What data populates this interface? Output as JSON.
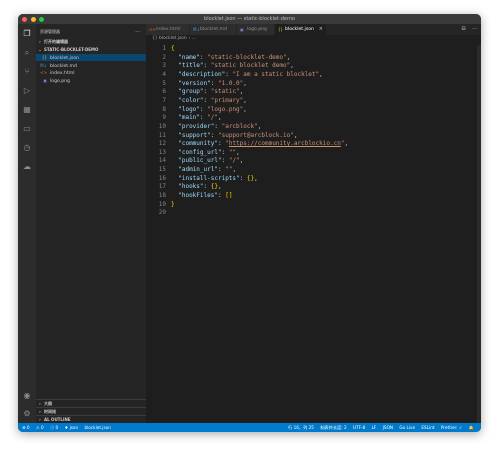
{
  "window": {
    "title": "blocklet.json — static-blocklet-demo",
    "traffic_lights": [
      "#fe5f57",
      "#febc2e",
      "#28c840"
    ]
  },
  "activity_bar": {
    "icons": [
      "files-icon",
      "search-icon",
      "source-control-icon",
      "run-debug-icon",
      "extensions-icon",
      "remote-explorer-icon",
      "timeline-icon",
      "docker-icon"
    ],
    "bottom_icons": [
      "account-icon",
      "settings-gear-icon"
    ]
  },
  "sidebar": {
    "title": "资源管理器",
    "more": "···",
    "open_editors": "打开的编辑器",
    "folder": "STATIC-BLOCKLET-DEMO",
    "files": [
      {
        "name": "blocklet.json",
        "icon": "{}",
        "color": "#e8c547",
        "selected": true
      },
      {
        "name": "blocklet.md",
        "icon": "M↓",
        "color": "#519aba",
        "selected": false
      },
      {
        "name": "index.html",
        "icon": "<>",
        "color": "#e37933",
        "selected": false
      },
      {
        "name": "logo.png",
        "icon": "▣",
        "color": "#a074c4",
        "selected": false
      }
    ],
    "bottom_sections": [
      "大纲",
      "时间线",
      "AL OUTLINE"
    ]
  },
  "tabs": [
    {
      "label": "index.html",
      "icon": "<>",
      "color": "#e37933",
      "active": false
    },
    {
      "label": "blocklet.md",
      "icon": "M↓",
      "color": "#519aba",
      "active": false
    },
    {
      "label": "logo.png",
      "icon": "▣",
      "color": "#a074c4",
      "active": false
    },
    {
      "label": "blocklet.json",
      "icon": "{}",
      "color": "#e8c547",
      "active": true
    }
  ],
  "tab_actions": [
    "⊟",
    "···"
  ],
  "breadcrumb": [
    "{} blocklet.json",
    "› ..."
  ],
  "code": [
    {
      "n": "1",
      "parts": [
        [
          "b",
          "{"
        ]
      ]
    },
    {
      "n": "2",
      "parts": [
        [
          "p",
          "  "
        ],
        [
          "k",
          "\"name\""
        ],
        [
          "p",
          ": "
        ],
        [
          "s",
          "\"static-blocklet-demo\""
        ],
        [
          "p",
          ","
        ]
      ]
    },
    {
      "n": "3",
      "parts": [
        [
          "p",
          "  "
        ],
        [
          "k",
          "\"title\""
        ],
        [
          "p",
          ": "
        ],
        [
          "s",
          "\"static blocklet demo\""
        ],
        [
          "p",
          ","
        ]
      ]
    },
    {
      "n": "4",
      "parts": [
        [
          "p",
          "  "
        ],
        [
          "k",
          "\"description\""
        ],
        [
          "p",
          ": "
        ],
        [
          "s",
          "\"I am a static blocklet\""
        ],
        [
          "p",
          ","
        ]
      ]
    },
    {
      "n": "5",
      "parts": [
        [
          "p",
          "  "
        ],
        [
          "k",
          "\"version\""
        ],
        [
          "p",
          ": "
        ],
        [
          "s",
          "\"1.0.0\""
        ],
        [
          "p",
          ","
        ]
      ]
    },
    {
      "n": "6",
      "parts": [
        [
          "p",
          "  "
        ],
        [
          "k",
          "\"group\""
        ],
        [
          "p",
          ": "
        ],
        [
          "s",
          "\"static\""
        ],
        [
          "p",
          ","
        ]
      ]
    },
    {
      "n": "7",
      "parts": [
        [
          "p",
          "  "
        ],
        [
          "k",
          "\"color\""
        ],
        [
          "p",
          ": "
        ],
        [
          "s",
          "\"primary\""
        ],
        [
          "p",
          ","
        ]
      ]
    },
    {
      "n": "8",
      "parts": [
        [
          "p",
          "  "
        ],
        [
          "k",
          "\"logo\""
        ],
        [
          "p",
          ": "
        ],
        [
          "s",
          "\"logo.png\""
        ],
        [
          "p",
          ","
        ]
      ]
    },
    {
      "n": "9",
      "parts": [
        [
          "p",
          "  "
        ],
        [
          "k",
          "\"main\""
        ],
        [
          "p",
          ": "
        ],
        [
          "s",
          "\"/\""
        ],
        [
          "p",
          ","
        ]
      ]
    },
    {
      "n": "10",
      "parts": [
        [
          "p",
          "  "
        ],
        [
          "k",
          "\"provider\""
        ],
        [
          "p",
          ": "
        ],
        [
          "s",
          "\"arcblock\""
        ],
        [
          "p",
          ","
        ]
      ]
    },
    {
      "n": "11",
      "parts": [
        [
          "p",
          "  "
        ],
        [
          "k",
          "\"support\""
        ],
        [
          "p",
          ": "
        ],
        [
          "s",
          "\"support@arcblock.io\""
        ],
        [
          "p",
          ","
        ]
      ]
    },
    {
      "n": "12",
      "parts": [
        [
          "p",
          "  "
        ],
        [
          "k",
          "\"community\""
        ],
        [
          "p",
          ": "
        ],
        [
          "s",
          "\""
        ],
        [
          "link",
          "https://community.arcblockio.cn"
        ],
        [
          "s",
          "\""
        ],
        [
          "p",
          ","
        ]
      ]
    },
    {
      "n": "13",
      "parts": [
        [
          "p",
          "  "
        ],
        [
          "k",
          "\"config_url\""
        ],
        [
          "p",
          ": "
        ],
        [
          "s",
          "\"\""
        ],
        [
          "p",
          ","
        ]
      ]
    },
    {
      "n": "14",
      "parts": [
        [
          "p",
          "  "
        ],
        [
          "k",
          "\"public_url\""
        ],
        [
          "p",
          ": "
        ],
        [
          "s",
          "\"/\""
        ],
        [
          "p",
          ","
        ]
      ]
    },
    {
      "n": "15",
      "parts": [
        [
          "p",
          "  "
        ],
        [
          "k",
          "\"admin_url\""
        ],
        [
          "p",
          ": "
        ],
        [
          "s",
          "\"\""
        ],
        [
          "p",
          ","
        ]
      ]
    },
    {
      "n": "16",
      "parts": [
        [
          "p",
          "  "
        ],
        [
          "k",
          "\"install-scripts\""
        ],
        [
          "p",
          ": "
        ],
        [
          "b",
          "{}"
        ],
        [
          "p",
          ","
        ]
      ]
    },
    {
      "n": "17",
      "parts": [
        [
          "p",
          "  "
        ],
        [
          "k",
          "\"hooks\""
        ],
        [
          "p",
          ": "
        ],
        [
          "b",
          "{}"
        ],
        [
          "p",
          ","
        ]
      ]
    },
    {
      "n": "18",
      "parts": [
        [
          "p",
          "  "
        ],
        [
          "k",
          "\"hookFiles\""
        ],
        [
          "p",
          ": "
        ],
        [
          "b",
          "[]"
        ]
      ]
    },
    {
      "n": "19",
      "parts": [
        [
          "b",
          "}"
        ]
      ]
    },
    {
      "n": "20",
      "parts": []
    }
  ],
  "status": {
    "left": [
      "⊗ 0",
      "⚠ 0",
      "ⓘ 0",
      "♦ json",
      "blocklet.json"
    ],
    "right": [
      "行 16，列 25",
      "制表符长度: 2",
      "UTF-8",
      "LF",
      "JSON",
      "Go Live",
      "ESLint",
      "Prettier: ✓",
      "🔔"
    ]
  }
}
